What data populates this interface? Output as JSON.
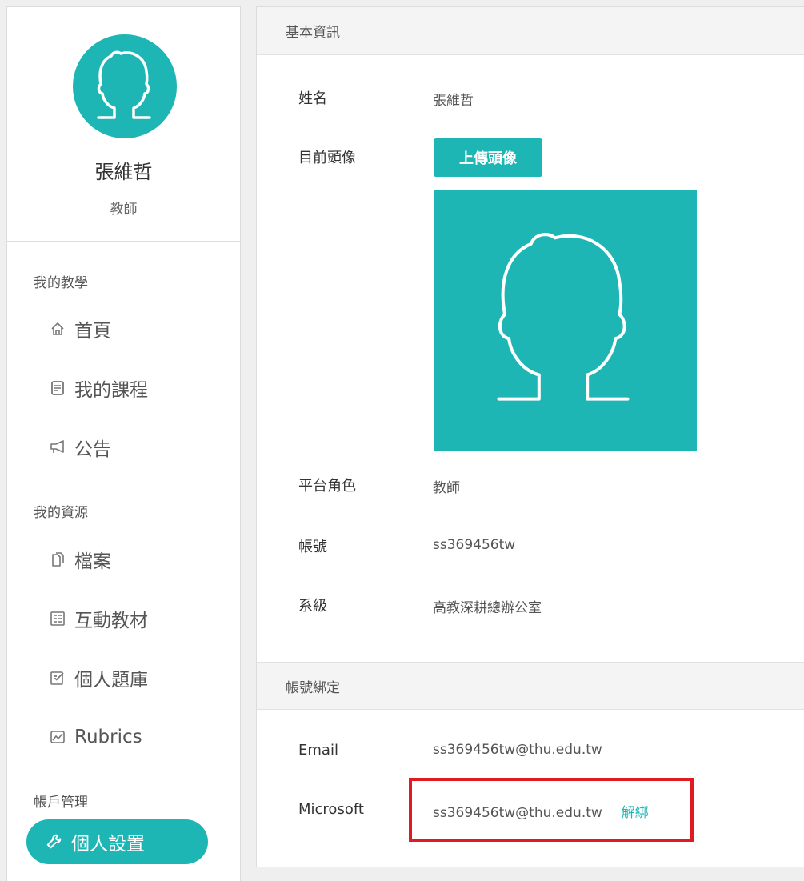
{
  "profile": {
    "name": "張維哲",
    "role": "教師"
  },
  "sidebar": {
    "sections": [
      {
        "title": "我的教學"
      },
      {
        "title": "我的資源"
      },
      {
        "title": "帳戶管理"
      }
    ],
    "items": [
      {
        "label": "首頁",
        "icon": "home-icon"
      },
      {
        "label": "我的課程",
        "icon": "document-icon"
      },
      {
        "label": "公告",
        "icon": "megaphone-icon"
      },
      {
        "label": "檔案",
        "icon": "files-icon"
      },
      {
        "label": "互動教材",
        "icon": "calculator-icon"
      },
      {
        "label": "個人題庫",
        "icon": "edit-icon"
      },
      {
        "label": "Rubrics",
        "icon": "chart-icon"
      }
    ],
    "active": {
      "label": "個人設置",
      "icon": "wrench-icon"
    }
  },
  "basic_info": {
    "header": "基本資訊",
    "name_label": "姓名",
    "name_value": "張維哲",
    "avatar_label": "目前頭像",
    "upload_label": "上傳頭像",
    "role_label": "平台角色",
    "role_value": "教師",
    "account_label": "帳號",
    "account_value": "ss369456tw",
    "dept_label": "系級",
    "dept_value": "高教深耕總辦公室"
  },
  "binding": {
    "header": "帳號綁定",
    "email_label": "Email",
    "email_value": "ss369456tw@thu.edu.tw",
    "microsoft_label": "Microsoft",
    "microsoft_value": "ss369456tw@thu.edu.tw",
    "unbind_label": "解綁"
  },
  "colors": {
    "accent": "#1eb5b5",
    "highlight": "#e11b22"
  }
}
